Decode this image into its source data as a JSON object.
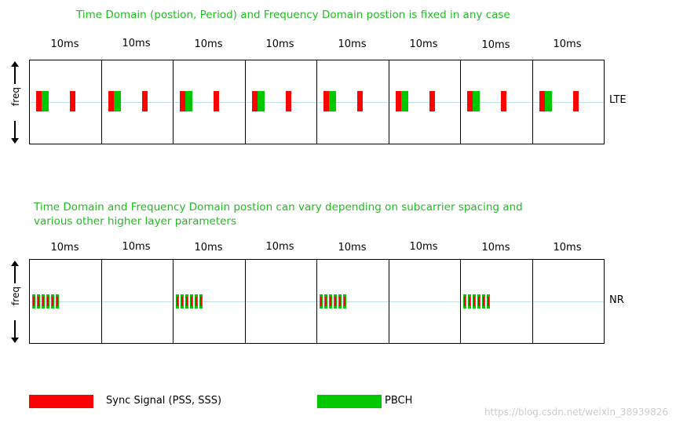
{
  "lte_section": {
    "title": "Time Domain (postion, Period) and Frequency Domain postion is fixed in any case",
    "frame_labels": [
      "10ms",
      "10ms",
      "10ms",
      "10ms",
      "10ms",
      "10ms",
      "10ms",
      "10ms"
    ],
    "axis_label": "freq",
    "row_label": "LTE"
  },
  "nr_section": {
    "title": "Time Domain and Frequency Domain postion can vary depending on subcarrier spacing and\nvarious other higher layer parameters",
    "frame_labels": [
      "10ms",
      "10ms",
      "10ms",
      "10ms",
      "10ms",
      "10ms",
      "10ms",
      "10ms"
    ],
    "axis_label": "freq",
    "row_label": "NR"
  },
  "legend": {
    "sync_label": "Sync Signal (PSS, SSS)",
    "pbch_label": "PBCH"
  },
  "watermark": "https://blog.csdn.net/weixin_38939826",
  "colors": {
    "sync": "#ff0000",
    "pbch": "#00c800",
    "title": "#22bb22"
  }
}
